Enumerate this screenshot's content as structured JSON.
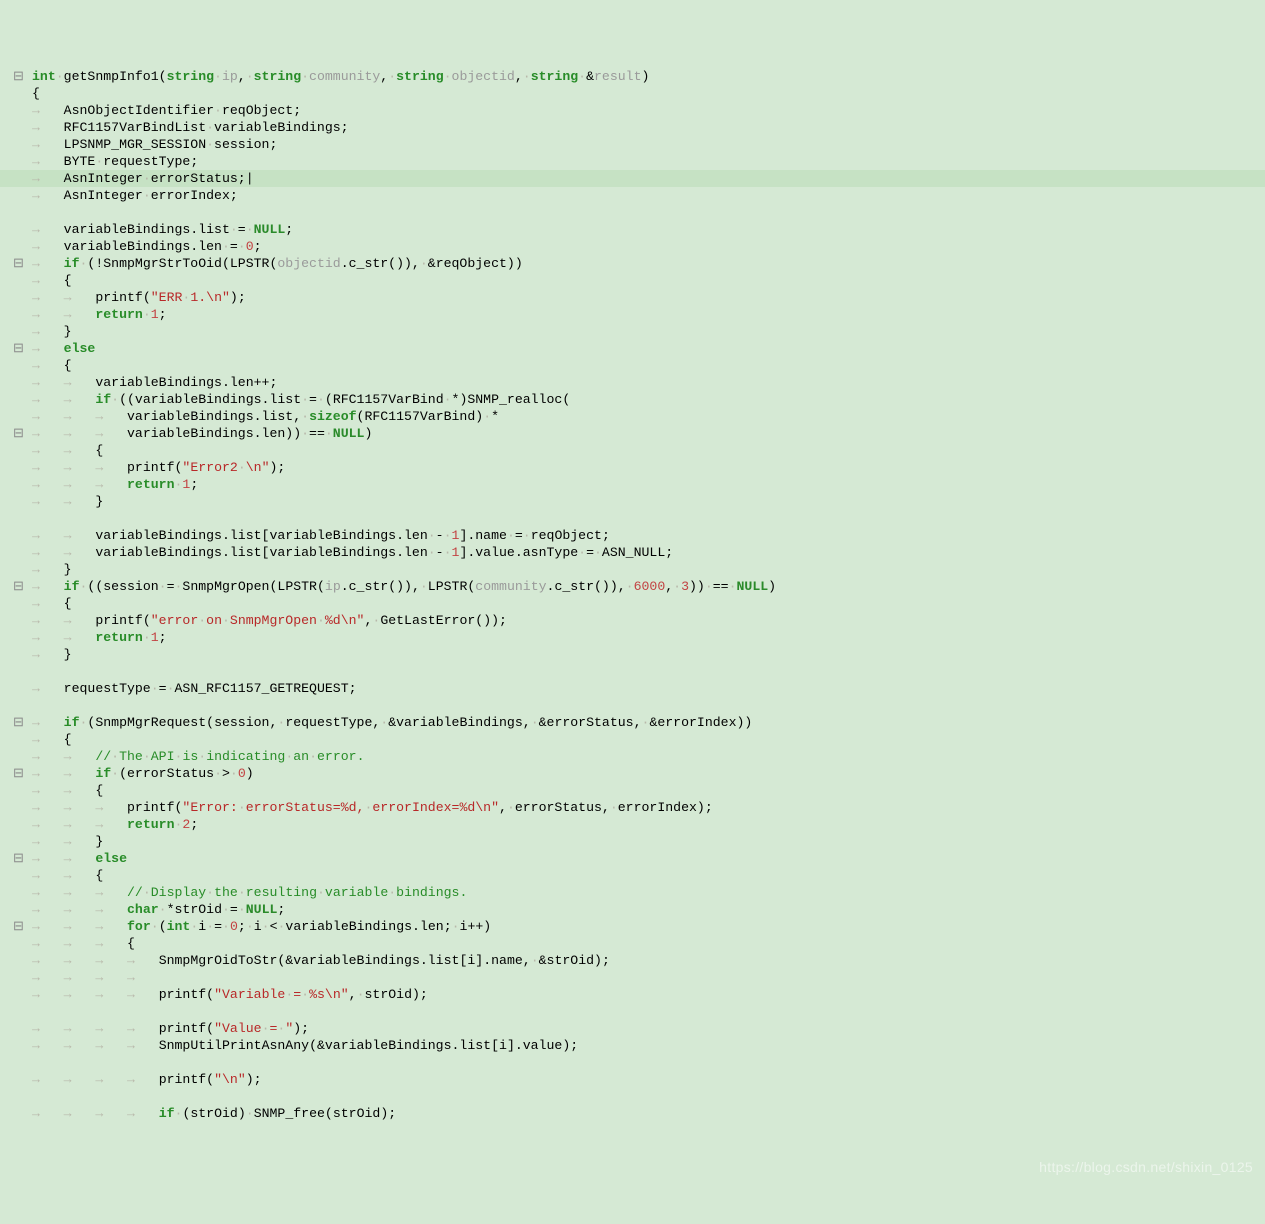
{
  "watermark": "https://blog.csdn.net/shixin_0125",
  "tok": {
    "int": "int",
    "string": "string",
    "char": "char",
    "for": "for",
    "if": "if",
    "else": "else",
    "return": "return",
    "sizeof": "sizeof",
    "NULL": "NULL",
    "ip": "ip",
    "community": "community",
    "objectid": "objectid",
    "result": "result"
  },
  "s": {
    "err1": "\"ERR·1.\\n\"",
    "err2": "\"Error2·\\n\"",
    "errOpen": "\"error·on·SnmpMgrOpen·%d\\n\"",
    "errStat": "\"Error:·errorStatus=%d,·errorIndex=%d\\n\"",
    "var": "\"Variable·=·%s\\n\"",
    "val": "\"Value·=·\"",
    "nl": "\"\\n\""
  },
  "n": {
    "zero": "0",
    "one": "1",
    "two": "2",
    "three": "3",
    "six000": "6000"
  },
  "txt": {
    "fn": "getSnmpInfo1",
    "asnObj": "AsnObjectIdentifier",
    "reqObj": "reqObject",
    "rfcList": "RFC1157VarBindList",
    "vb": "variableBindings",
    "lpsess": "LPSNMP_MGR_SESSION",
    "sess": "session",
    "byte": "BYTE",
    "reqType": "requestType",
    "asnInt": "AsnInteger",
    "errStat": "errorStatus",
    "errIdx": "errorIndex",
    "list": ".list",
    "len": ".len",
    "strToOid": "SnmpMgrStrToOid",
    "lpstr": "LPSTR",
    "cstr": ".c_str()",
    "printf": "printf",
    "rfcVB": "RFC1157VarBind",
    "realloc": "SNMP_realloc",
    "name": ".name",
    "valueAsn": ".value.asnType",
    "asnNull": "ASN_NULL",
    "open": "SnmpMgrOpen",
    "gle": "GetLastError()",
    "asnReq": "ASN_RFC1157_GETREQUEST",
    "req": "SnmpMgrRequest",
    "cmtApi": "//·The·API·is·indicating·an·error.",
    "cmtDisp": "//·Display·the·resulting·variable·bindings.",
    "strOid": "strOid",
    "oidToStr": "SnmpMgrOidToStr",
    "printAny": "SnmpUtilPrintAsnAny",
    "value": ".value",
    "free": "SNMP_free",
    "i": "i"
  }
}
